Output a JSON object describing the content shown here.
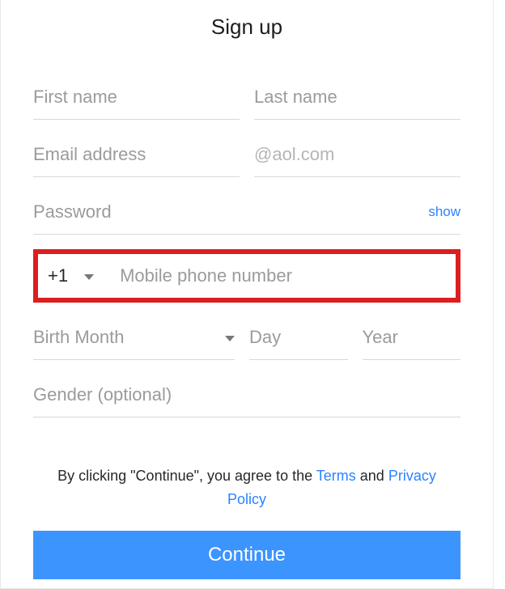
{
  "title": "Sign up",
  "fields": {
    "first_name": {
      "placeholder": "First name"
    },
    "last_name": {
      "placeholder": "Last name"
    },
    "email": {
      "placeholder": "Email address"
    },
    "email_domain": {
      "placeholder": "@aol.com"
    },
    "password": {
      "placeholder": "Password",
      "show_label": "show"
    },
    "phone": {
      "country_code": "+1",
      "placeholder": "Mobile phone number"
    },
    "birth_month": {
      "placeholder": "Birth Month"
    },
    "birth_day": {
      "placeholder": "Day"
    },
    "birth_year": {
      "placeholder": "Year"
    },
    "gender": {
      "placeholder": "Gender (optional)"
    }
  },
  "legal": {
    "prefix": "By clicking \"Continue\", you agree to the ",
    "terms": "Terms",
    "and": " and ",
    "privacy": "Privacy Policy"
  },
  "continue_label": "Continue",
  "colors": {
    "accent": "#3c94ff",
    "highlight_border": "#db1f1f",
    "link": "#2b83ff"
  }
}
